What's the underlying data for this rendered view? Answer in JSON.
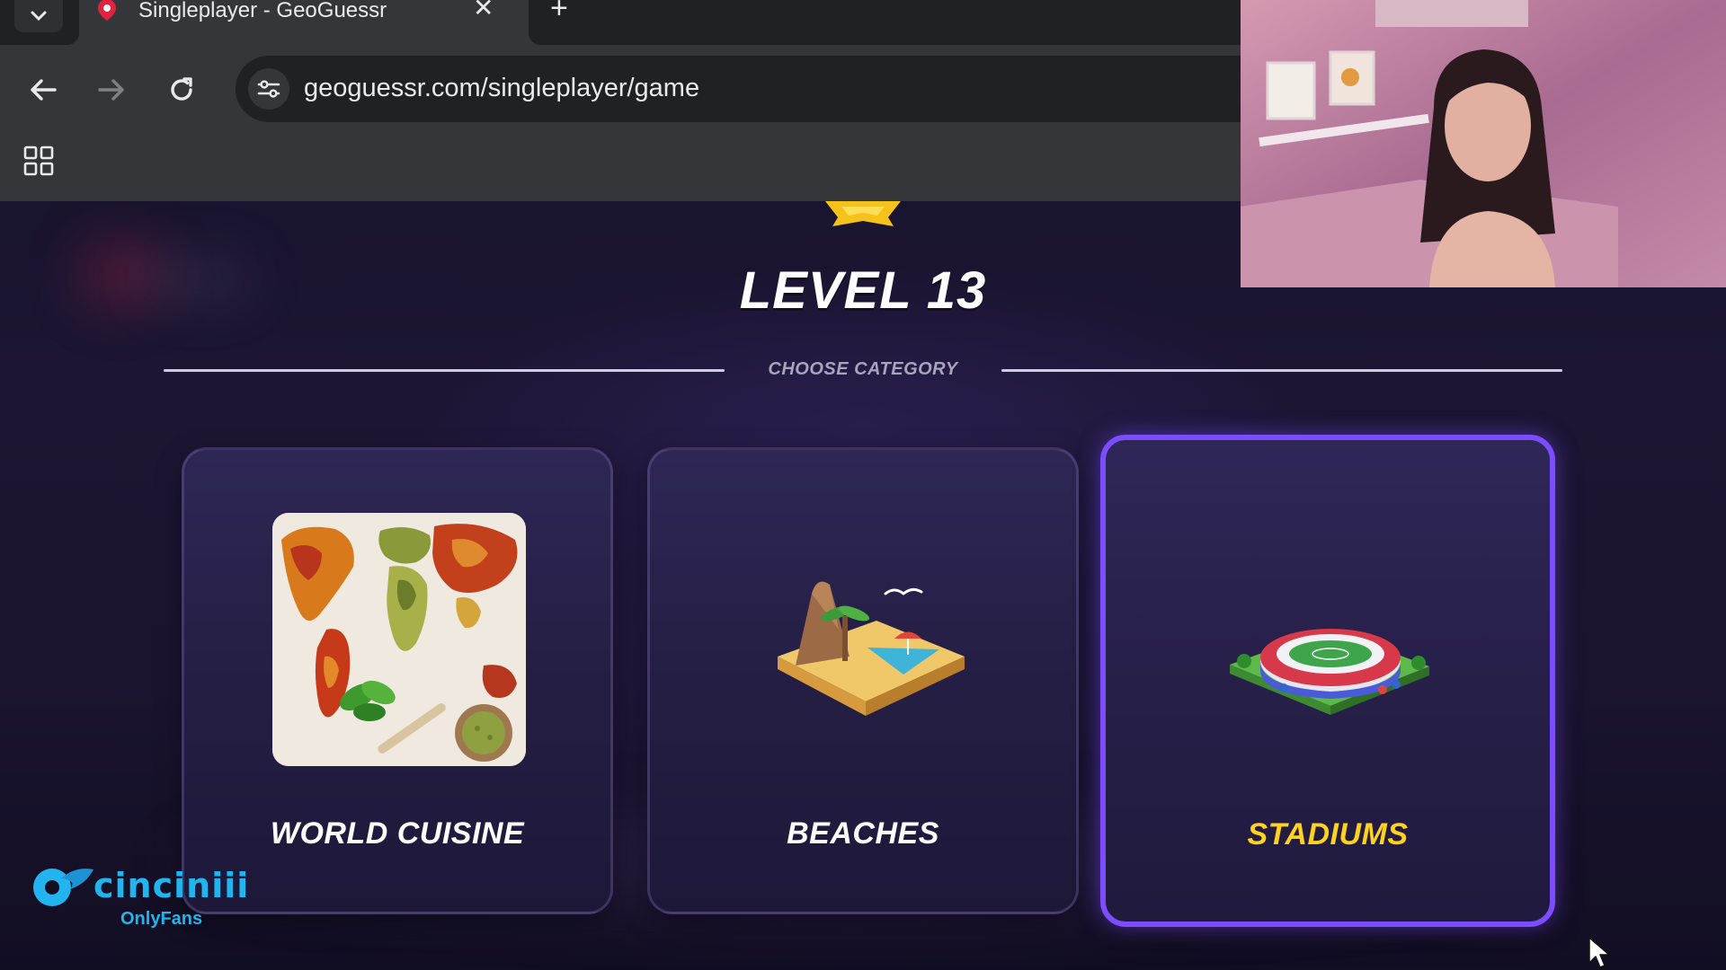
{
  "browser": {
    "tab_title": "Singleplayer - GeoGuessr",
    "tab_close": "✕",
    "new_tab": "+",
    "url": "geoguessr.com/singleplayer/game"
  },
  "game": {
    "level_title": "LEVEL 13",
    "choose_category": "CHOOSE CATEGORY",
    "categories": [
      {
        "label": "WORLD CUISINE",
        "selected": false
      },
      {
        "label": "BEACHES",
        "selected": false
      },
      {
        "label": "STADIUMS",
        "selected": true
      }
    ],
    "accent_color": "#7b4dff",
    "selected_label_color": "#ffd21f"
  },
  "overlay": {
    "watermark_name": "cinciniii",
    "watermark_sub": "OnlyFans"
  }
}
